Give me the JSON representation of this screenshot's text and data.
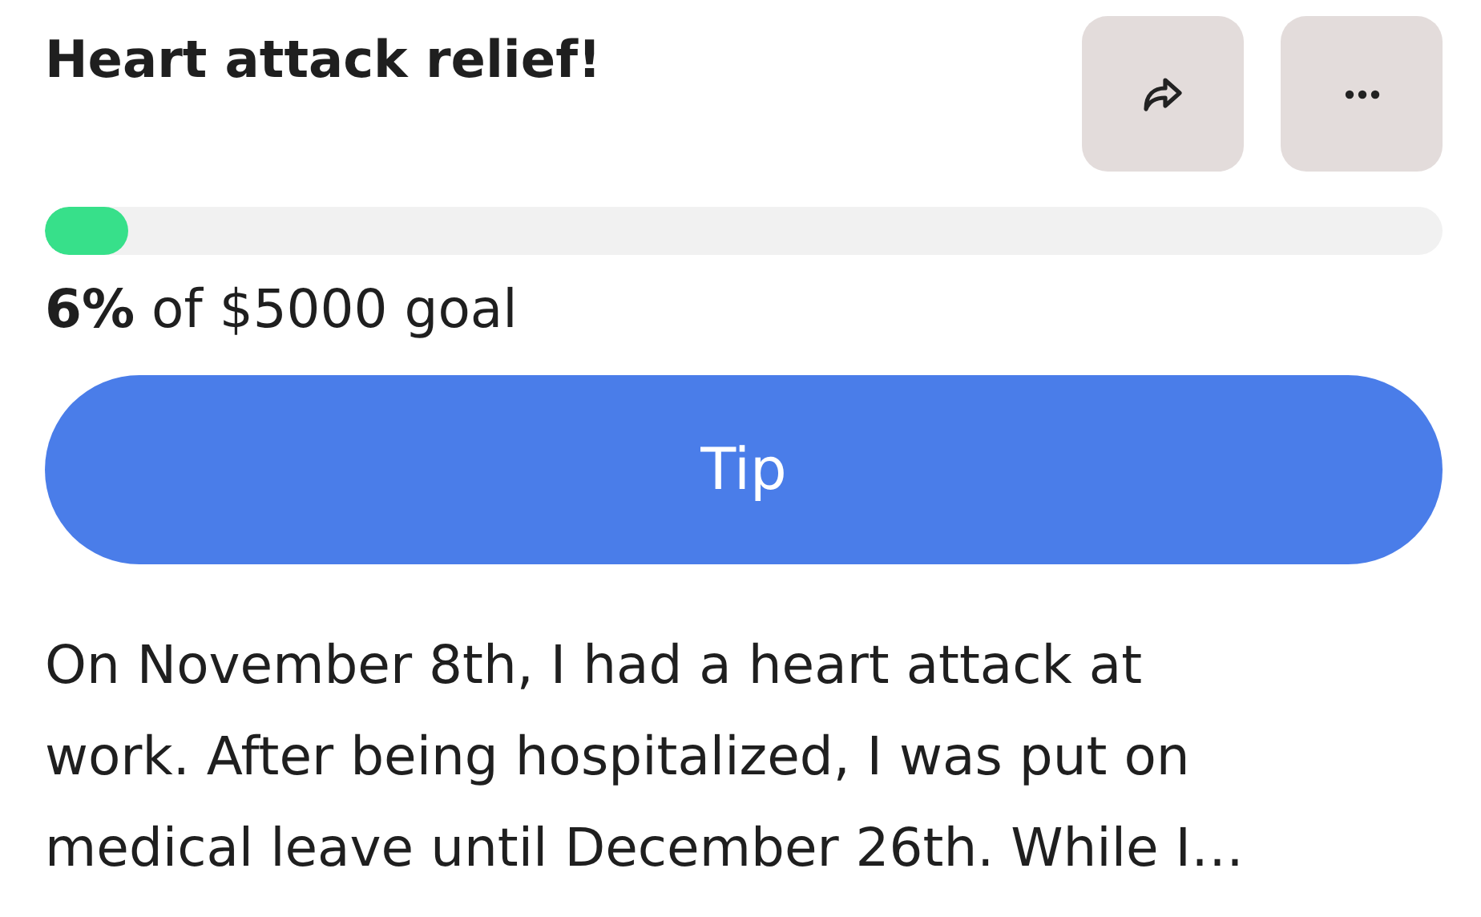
{
  "title": "Heart attack relief!",
  "actions": [
    {
      "kind": "share"
    },
    {
      "kind": "more"
    }
  ],
  "progress": {
    "level": 0.06,
    "caption": "**6%** of $5000 goal"
  },
  "tip_button": {
    "label": "Tip"
  },
  "story": "On November 8th, I had a heart attack at\nwork. After being hospitalized, I was put on\nmedical leave until December 26th. While I…"
}
